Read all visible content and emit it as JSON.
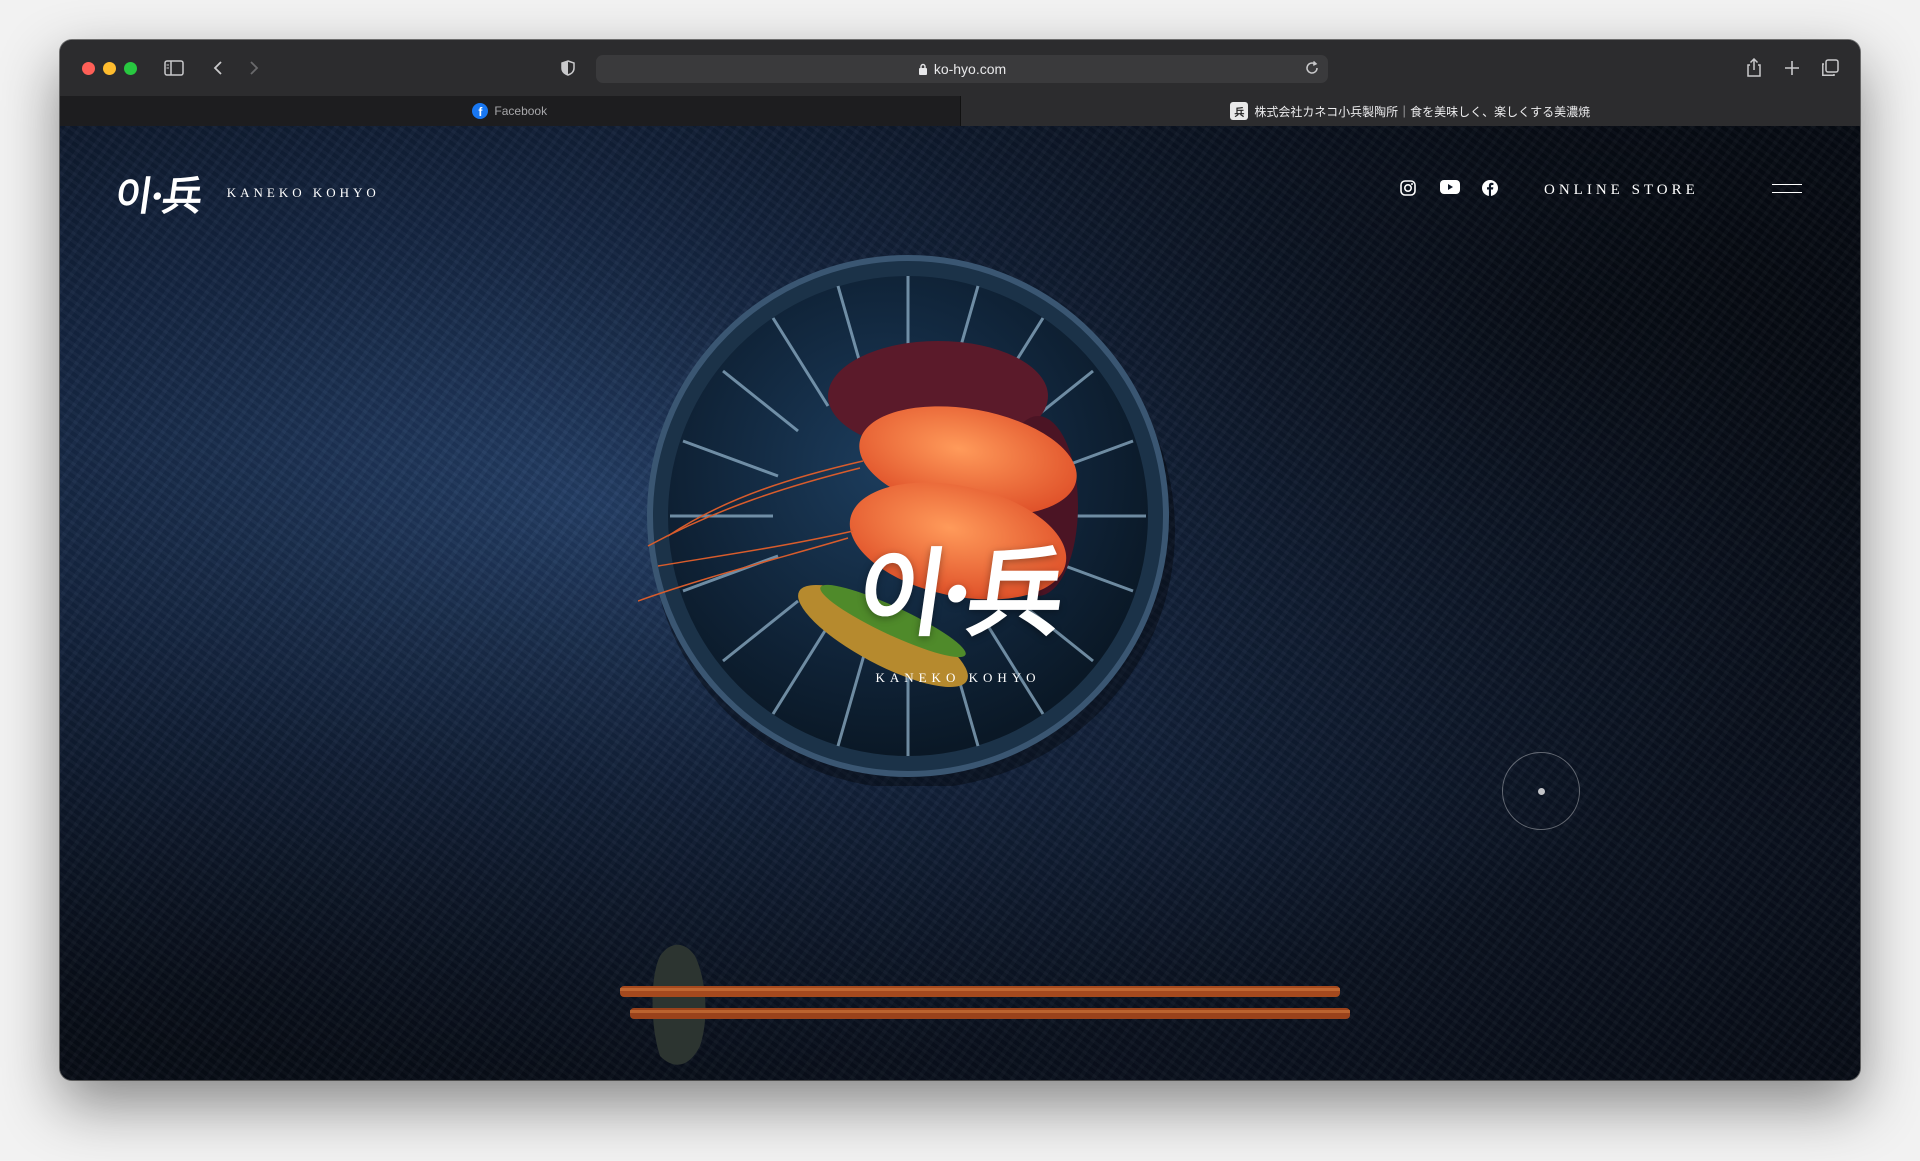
{
  "browser": {
    "url": "ko-hyo.com",
    "tabs": [
      {
        "label": "Facebook",
        "favicon": "facebook-icon",
        "active": false
      },
      {
        "label": "株式会社カネコ小兵製陶所｜食を美味しく、楽しくする美濃焼",
        "favicon": "kohyo-favicon",
        "active": true
      }
    ]
  },
  "site": {
    "logo_mark": "이·兵",
    "brand_name": "KANEKO KOHYO",
    "nav": {
      "online_store": "ONLINE STORE",
      "social_icons": [
        "instagram-icon",
        "youtube-icon",
        "facebook-icon"
      ]
    },
    "hero": {
      "logo_mark": "이·兵",
      "brand_name": "KANEKO KOHYO"
    }
  },
  "colors": {
    "background_navy": "#162846",
    "text": "#ffffff",
    "facebook_blue": "#1877f2"
  }
}
